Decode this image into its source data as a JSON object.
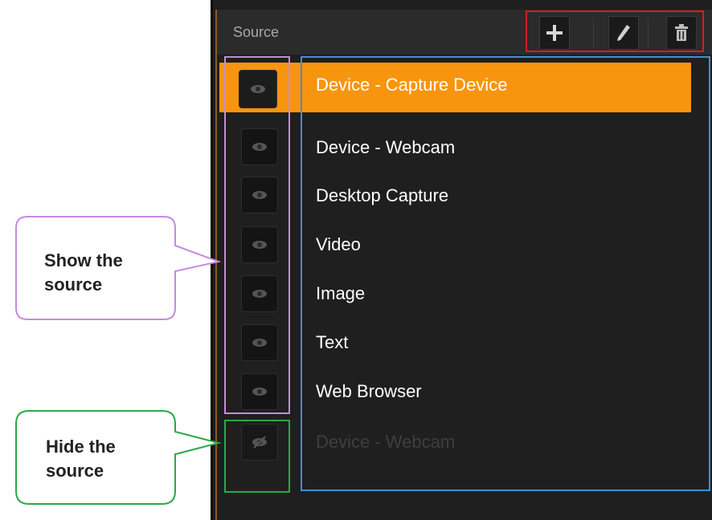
{
  "panel": {
    "title": "Source",
    "toolbar": {
      "add_icon": "plus-icon",
      "edit_icon": "pencil-icon",
      "delete_icon": "trash-icon"
    },
    "sources": [
      {
        "label": "Device - Capture Device",
        "visible": true,
        "selected": true
      },
      {
        "label": "Device - Webcam",
        "visible": true,
        "selected": false
      },
      {
        "label": "Desktop Capture",
        "visible": true,
        "selected": false
      },
      {
        "label": "Video",
        "visible": true,
        "selected": false
      },
      {
        "label": "Image",
        "visible": true,
        "selected": false
      },
      {
        "label": "Text",
        "visible": true,
        "selected": false
      },
      {
        "label": "Web Browser",
        "visible": true,
        "selected": false
      },
      {
        "label": "Device - Webcam",
        "visible": false,
        "selected": false
      }
    ]
  },
  "callouts": {
    "show": {
      "line1": "Show the",
      "line2": "source"
    },
    "hide": {
      "line1": "Hide the",
      "line2": "source"
    }
  },
  "colors": {
    "selected_row": "#f7950f",
    "panel_bg": "#1f1f1f",
    "toolbar_highlight": "#d0211f",
    "show_highlight": "#c48be0",
    "hide_highlight": "#2aa84a",
    "list_highlight": "#3e8fe0"
  }
}
